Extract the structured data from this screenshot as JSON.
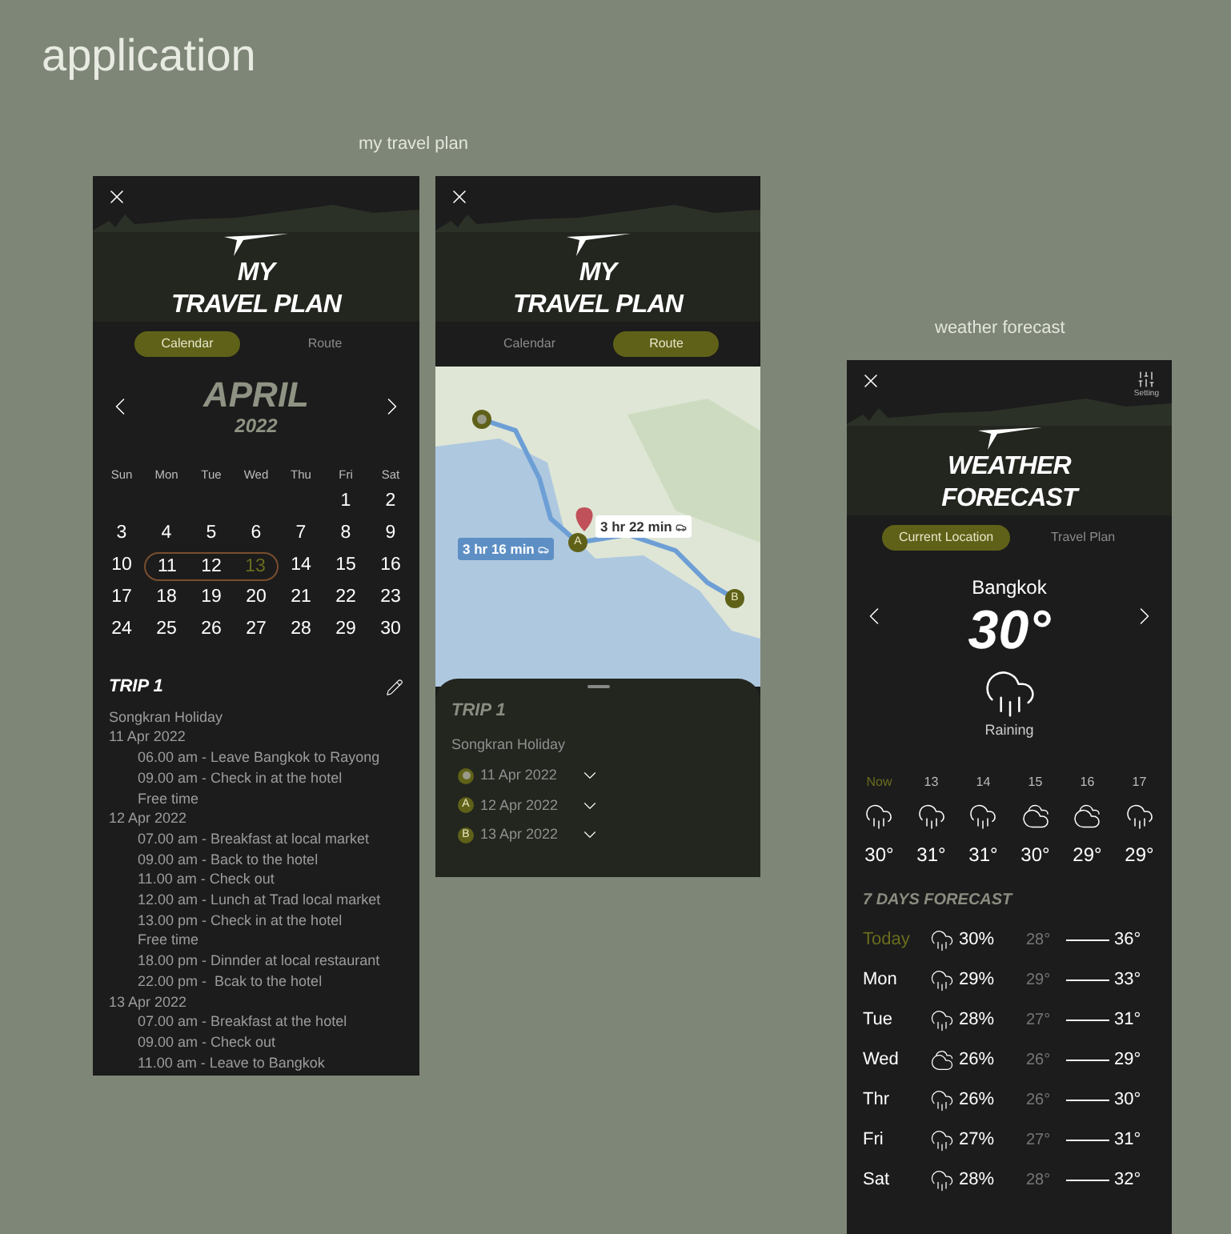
{
  "canvas": {
    "title": "application"
  },
  "travel_plan": {
    "label": "my travel plan",
    "calendar_screen": {
      "title_lines": [
        "MY",
        "TRAVEL PLAN"
      ],
      "tabs": [
        {
          "label": "Calendar",
          "selected": true
        },
        {
          "label": "Route",
          "selected": false
        }
      ],
      "month": "APRIL",
      "year": "2022",
      "weekdays": [
        "Sun",
        "Mon",
        "Tue",
        "Wed",
        "Thu",
        "Fri",
        "Sat"
      ],
      "weeks": [
        [
          {
            "kind": "blank"
          },
          {
            "kind": "blank"
          },
          {
            "kind": "blank"
          },
          {
            "kind": "blank"
          },
          {
            "kind": "blank"
          },
          {
            "kind": "day",
            "day": "1",
            "in_trip": false,
            "current": false
          },
          {
            "kind": "day",
            "day": "2",
            "in_trip": false,
            "current": false
          }
        ],
        [
          {
            "kind": "day",
            "day": "3",
            "in_trip": false,
            "current": false
          },
          {
            "kind": "day",
            "day": "4",
            "in_trip": false,
            "current": false
          },
          {
            "kind": "day",
            "day": "5",
            "in_trip": false,
            "current": false
          },
          {
            "kind": "day",
            "day": "6",
            "in_trip": false,
            "current": false
          },
          {
            "kind": "day",
            "day": "7",
            "in_trip": false,
            "current": false
          },
          {
            "kind": "day",
            "day": "8",
            "in_trip": false,
            "current": false
          },
          {
            "kind": "day",
            "day": "9",
            "in_trip": false,
            "current": false
          }
        ],
        [
          {
            "kind": "day",
            "day": "10",
            "in_trip": false,
            "current": false
          },
          {
            "kind": "day",
            "day": "11",
            "in_trip": true,
            "current": false
          },
          {
            "kind": "day",
            "day": "12",
            "in_trip": true,
            "current": false
          },
          {
            "kind": "day",
            "day": "13",
            "in_trip": true,
            "current": true
          },
          {
            "kind": "day",
            "day": "14",
            "in_trip": false,
            "current": false
          },
          {
            "kind": "day",
            "day": "15",
            "in_trip": false,
            "current": false
          },
          {
            "kind": "day",
            "day": "16",
            "in_trip": false,
            "current": false
          }
        ],
        [
          {
            "kind": "day",
            "day": "17",
            "in_trip": false,
            "current": false
          },
          {
            "kind": "day",
            "day": "18",
            "in_trip": false,
            "current": false
          },
          {
            "kind": "day",
            "day": "19",
            "in_trip": false,
            "current": false
          },
          {
            "kind": "day",
            "day": "20",
            "in_trip": false,
            "current": false
          },
          {
            "kind": "day",
            "day": "21",
            "in_trip": false,
            "current": false
          },
          {
            "kind": "day",
            "day": "22",
            "in_trip": false,
            "current": false
          },
          {
            "kind": "day",
            "day": "23",
            "in_trip": false,
            "current": false
          }
        ],
        [
          {
            "kind": "day",
            "day": "24",
            "in_trip": false,
            "current": false
          },
          {
            "kind": "day",
            "day": "25",
            "in_trip": false,
            "current": false
          },
          {
            "kind": "day",
            "day": "26",
            "in_trip": false,
            "current": false
          },
          {
            "kind": "day",
            "day": "27",
            "in_trip": false,
            "current": false
          },
          {
            "kind": "day",
            "day": "28",
            "in_trip": false,
            "current": false
          },
          {
            "kind": "day",
            "day": "29",
            "in_trip": false,
            "current": false
          },
          {
            "kind": "day",
            "day": "30",
            "in_trip": false,
            "current": false
          }
        ]
      ],
      "trip": {
        "title": "TRIP 1",
        "name": "Songkran Holiday",
        "days": [
          {
            "date": "11 Apr 2022",
            "items": [
              "06.00 am - Leave Bangkok to Rayong",
              "09.00 am - Check in at the hotel",
              "Free time"
            ]
          },
          {
            "date": "12 Apr 2022",
            "items": [
              "07.00 am - Breakfast at local market",
              "09.00 am - Back to the hotel",
              "11.00 am - Check out",
              "12.00 am - Lunch at Trad local market",
              "13.00 pm - Check in at the hotel",
              "Free time",
              "18.00 pm - Dinnder at local restaurant",
              "22.00 pm -  Bcak to the hotel"
            ]
          },
          {
            "date": "13 Apr 2022",
            "items": [
              "07.00 am - Breakfast at the hotel",
              "09.00 am - Check out",
              "11.00 am - Leave to Bangkok"
            ]
          }
        ]
      }
    },
    "route_screen": {
      "title_lines": [
        "MY",
        "TRAVEL PLAN"
      ],
      "tabs": [
        {
          "label": "Calendar",
          "selected": false
        },
        {
          "label": "Route",
          "selected": true
        }
      ],
      "map": {
        "markers": [
          {
            "kind": "origin"
          },
          {
            "kind": "stop",
            "label": "A"
          },
          {
            "kind": "stop",
            "label": "B"
          }
        ],
        "callouts": [
          {
            "text": "3 hr 16 min",
            "selected": true
          },
          {
            "text": "3 hr 22 min",
            "selected": false
          }
        ]
      },
      "sheet": {
        "title": "TRIP 1",
        "name": "Songkran Holiday",
        "stops": [
          {
            "kind": "origin",
            "date": "11 Apr 2022",
            "expanded": false
          },
          {
            "kind": "stop",
            "label": "A",
            "date": "12 Apr 2022",
            "expanded": false
          },
          {
            "kind": "stop",
            "label": "B",
            "date": "13 Apr 2022",
            "expanded": false
          }
        ]
      }
    }
  },
  "weather": {
    "label": "weather forecast",
    "screen": {
      "setting_label": "Setting",
      "title_lines": [
        "WEATHER",
        "FORECAST"
      ],
      "tabs": [
        {
          "label": "Current Location",
          "selected": true
        },
        {
          "label": "Travel Plan",
          "selected": false
        }
      ],
      "city": "Bangkok",
      "temperature": "30°",
      "condition": "Raining",
      "hourly": [
        {
          "label": "Now",
          "current": true,
          "kind": "rain",
          "temp": "30°"
        },
        {
          "label": "13",
          "current": false,
          "kind": "rain",
          "temp": "31°"
        },
        {
          "label": "14",
          "current": false,
          "kind": "rain",
          "temp": "31°"
        },
        {
          "label": "15",
          "current": false,
          "kind": "cloudy",
          "temp": "30°"
        },
        {
          "label": "16",
          "current": false,
          "kind": "cloudy",
          "temp": "29°"
        },
        {
          "label": "17",
          "current": false,
          "kind": "rain",
          "temp": "29°"
        }
      ],
      "forecast_title": "7 DAYS FORECAST",
      "days": [
        {
          "day": "Today",
          "current": true,
          "kind": "rain",
          "chance": "30%",
          "low": "28°",
          "high": "36°"
        },
        {
          "day": "Mon",
          "current": false,
          "kind": "rain",
          "chance": "29%",
          "low": "29°",
          "high": "33°"
        },
        {
          "day": "Tue",
          "current": false,
          "kind": "rain",
          "chance": "28%",
          "low": "27°",
          "high": "31°"
        },
        {
          "day": "Wed",
          "current": false,
          "kind": "cloudy",
          "chance": "26%",
          "low": "26°",
          "high": "29°"
        },
        {
          "day": "Thr",
          "current": false,
          "kind": "rain",
          "chance": "26%",
          "low": "26°",
          "high": "30°"
        },
        {
          "day": "Fri",
          "current": false,
          "kind": "rain",
          "chance": "27%",
          "low": "27°",
          "high": "31°"
        },
        {
          "day": "Sat",
          "current": false,
          "kind": "rain",
          "chance": "28%",
          "low": "28°",
          "high": "32°"
        }
      ]
    }
  }
}
